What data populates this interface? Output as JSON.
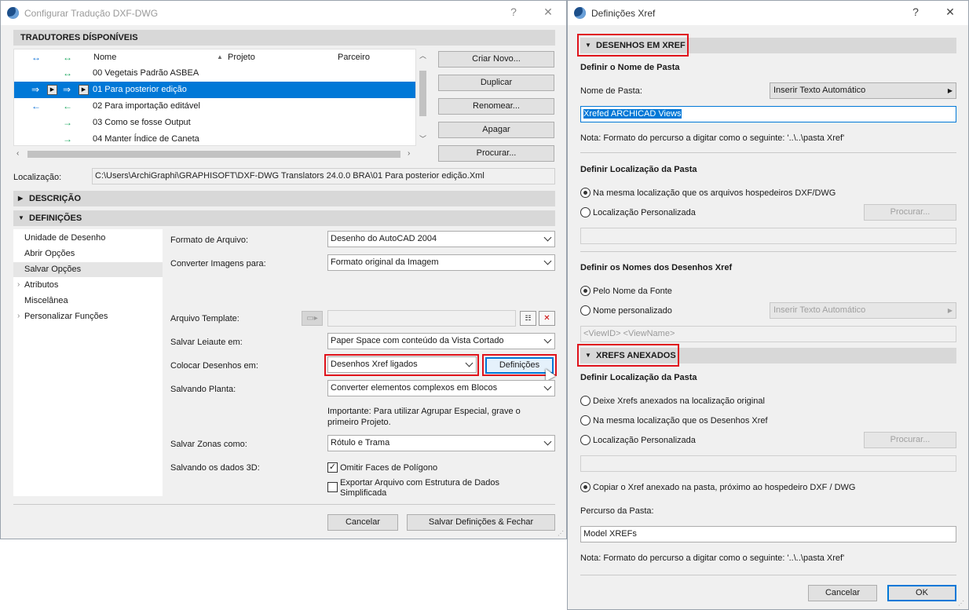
{
  "left_window": {
    "title": "Configurar Tradução DXF-DWG",
    "help": "?",
    "close": "✕"
  },
  "translators": {
    "header": "TRADUTORES DÍSPONÍVEIS",
    "columns": {
      "name": "Nome",
      "project": "Projeto",
      "partner": "Parceiro"
    },
    "rows": [
      {
        "name": "00 Vegetais Padrão ASBEA"
      },
      {
        "name": "01 Para posterior edição"
      },
      {
        "name": "02 Para importação editável"
      },
      {
        "name": "03 Como se fosse Output"
      },
      {
        "name": "04 Manter Índice de Caneta"
      }
    ],
    "buttons": {
      "new": "Criar Novo...",
      "duplicate": "Duplicar",
      "rename": "Renomear...",
      "delete": "Apagar",
      "browse": "Procurar..."
    }
  },
  "location": {
    "label": "Localização:",
    "value": "C:\\Users\\ArchiGraphi\\GRAPHISOFT\\DXF-DWG Translators 24.0.0 BRA\\01 Para posterior edição.Xml"
  },
  "description_header": "DESCRIÇÃO",
  "definitions_header": "DEFINIÇÕES",
  "tree": [
    "Unidade de Desenho",
    "Abrir Opções",
    "Salvar Opções",
    "Atributos",
    "Miscelânea",
    "Personalizar Funções"
  ],
  "form": {
    "file_format": {
      "label": "Formato de Arquivo:",
      "value": "Desenho do AutoCAD 2004"
    },
    "convert_images": {
      "label": "Converter Imagens para:",
      "value": "Formato original da Imagem"
    },
    "template": {
      "label": "Arquivo Template:"
    },
    "save_layout": {
      "label": "Salvar Leiaute em:",
      "value": "Paper Space com conteúdo da Vista Cortado"
    },
    "place_drawings": {
      "label": "Colocar Desenhos em:",
      "value": "Desenhos Xref ligados",
      "button": "Definições"
    },
    "saving_plan": {
      "label": "Salvando Planta:",
      "value": "Converter elementos complexos em Blocos"
    },
    "note": "Importante: Para utilizar Agrupar Especial, grave o primeiro Projeto.",
    "zones": {
      "label": "Salvar Zonas como:",
      "value": "Rótulo e Trama"
    },
    "data3d": {
      "label": "Salvando os dados 3D:",
      "omit": "Omitir Faces de Polígono",
      "export": "Exportar Arquivo com Estrutura de Dados Simplificada"
    }
  },
  "left_footer": {
    "cancel": "Cancelar",
    "save": "Salvar Definições & Fechar"
  },
  "right_window": {
    "title": "Definições Xref",
    "help": "?",
    "close": "✕"
  },
  "xref": {
    "sec1": "DESENHOS EM XREF",
    "folder_name_title": "Definir o Nome de Pasta",
    "folder_name_label": "Nome de Pasta:",
    "auto_text": "Inserir Texto Automático",
    "folder_value": "Xrefed ARCHICAD Views",
    "note": "Nota: Formato do percurso a digitar como o seguinte:   '..\\..\\pasta Xref'",
    "loc_title": "Definir Localização da Pasta",
    "loc_same": "Na mesma localização que os arquivos hospedeiros DXF/DWG",
    "loc_custom": "Localização Personalizada",
    "browse": "Procurar...",
    "names_title": "Definir os Nomes dos Desenhos Xref",
    "by_source": "Pelo Nome da Fonte",
    "custom_name": "Nome personalizado",
    "auto_text2": "Inserir Texto Automático",
    "name_pattern": "<ViewID> <ViewName>",
    "sec2": "XREFS ANEXADOS",
    "att_title": "Definir Localização da Pasta",
    "att_original": "Deixe Xrefs anexados na localização original",
    "att_same": "Na mesma localização que os Desenhos Xref",
    "att_custom": "Localização Personalizada",
    "browse2": "Procurar...",
    "copy": "Copiar o Xref anexado na pasta, próximo ao hospedeiro DXF / DWG",
    "path_label": "Percurso da Pasta:",
    "path_value": "Model XREFs",
    "note2": "Nota: Formato do percurso a digitar como o seguinte:   '..\\..\\pasta Xref'",
    "cancel": "Cancelar",
    "ok": "OK"
  }
}
